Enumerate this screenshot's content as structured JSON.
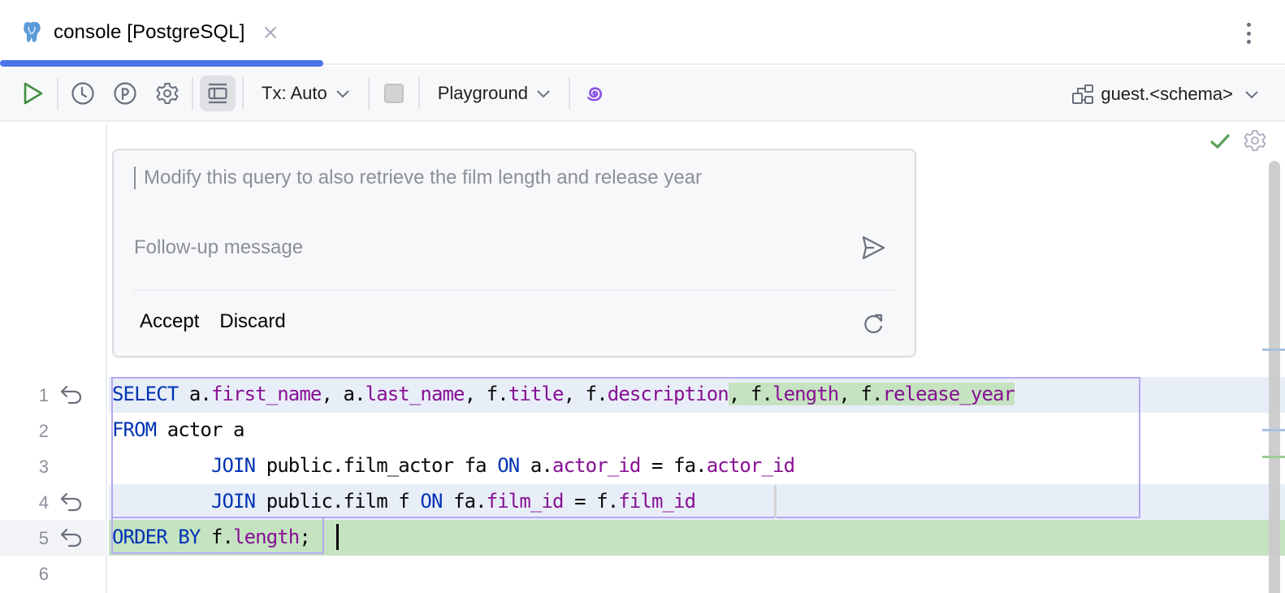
{
  "tab": {
    "title": "console [PostgreSQL]",
    "icon": "postgresql-elephant-icon",
    "close_icon": "close-icon",
    "active_color": "#4a74e8"
  },
  "toolbar": {
    "run_icon": "run-icon",
    "history_icon": "history-icon",
    "parameters_icon": "parameters-icon",
    "settings_icon": "gear-icon",
    "layout_icon": "editor-layout-icon",
    "tx_label": "Tx: Auto",
    "stop_icon": "stop-icon",
    "mode_label": "Playground",
    "ai_icon": "ai-assistant-spiral-icon",
    "schema_icon": "schema-icon",
    "schema_label": "guest.<schema>"
  },
  "editor_status": {
    "check_icon": "check-icon",
    "settings_icon": "gear-icon"
  },
  "ai_card": {
    "prompt": "Modify this query to also retrieve the film length and release year",
    "followup_placeholder": "Follow-up message",
    "send_icon": "send-icon",
    "accept_label": "Accept",
    "discard_label": "Discard",
    "regenerate_icon": "refresh-icon"
  },
  "code": {
    "lines": [
      {
        "num": "1",
        "revert": true,
        "tokens": [
          {
            "t": "SELECT",
            "c": "kw"
          },
          {
            "t": " a.",
            "c": ""
          },
          {
            "t": "first_name",
            "c": "col"
          },
          {
            "t": ", a.",
            "c": ""
          },
          {
            "t": "last_name",
            "c": "col"
          },
          {
            "t": ", f.",
            "c": ""
          },
          {
            "t": "title",
            "c": "col"
          },
          {
            "t": ", f.",
            "c": ""
          },
          {
            "t": "description",
            "c": "col"
          },
          {
            "t": ", f.",
            "c": "",
            "added": true
          },
          {
            "t": "length",
            "c": "col",
            "added": true
          },
          {
            "t": ", f.",
            "c": "",
            "added": true
          },
          {
            "t": "release_year",
            "c": "col",
            "added": true
          }
        ]
      },
      {
        "num": "2",
        "revert": false,
        "tokens": [
          {
            "t": "FROM",
            "c": "kw"
          },
          {
            "t": " actor a",
            "c": ""
          }
        ]
      },
      {
        "num": "3",
        "revert": false,
        "tokens": [
          {
            "t": "         ",
            "c": ""
          },
          {
            "t": "JOIN",
            "c": "kw"
          },
          {
            "t": " public.film_actor fa ",
            "c": ""
          },
          {
            "t": "ON",
            "c": "kw"
          },
          {
            "t": " a.",
            "c": ""
          },
          {
            "t": "actor_id",
            "c": "col"
          },
          {
            "t": " = fa.",
            "c": ""
          },
          {
            "t": "actor_id",
            "c": "col"
          }
        ]
      },
      {
        "num": "4",
        "revert": true,
        "tokens": [
          {
            "t": "         ",
            "c": ""
          },
          {
            "t": "JOIN",
            "c": "kw"
          },
          {
            "t": " public.film f ",
            "c": ""
          },
          {
            "t": "ON",
            "c": "kw"
          },
          {
            "t": " fa.",
            "c": ""
          },
          {
            "t": "film_id",
            "c": "col"
          },
          {
            "t": " = f.",
            "c": ""
          },
          {
            "t": "film_id",
            "c": "col"
          }
        ]
      },
      {
        "num": "5",
        "revert": true,
        "tokens": [
          {
            "t": "ORDER BY",
            "c": "kw"
          },
          {
            "t": " f.",
            "c": ""
          },
          {
            "t": "length",
            "c": "col"
          },
          {
            "t": ";",
            "c": ""
          }
        ]
      },
      {
        "num": "6",
        "revert": false,
        "tokens": []
      }
    ]
  },
  "colors": {
    "keyword": "#0033b3",
    "column": "#871094",
    "added_bg": "#c5e3c0",
    "modified_bg": "#e8eef8",
    "diff_frame": "#b6a8f0",
    "run_green": "#3f8f3f",
    "ai_purple": "#8a4fe8"
  }
}
